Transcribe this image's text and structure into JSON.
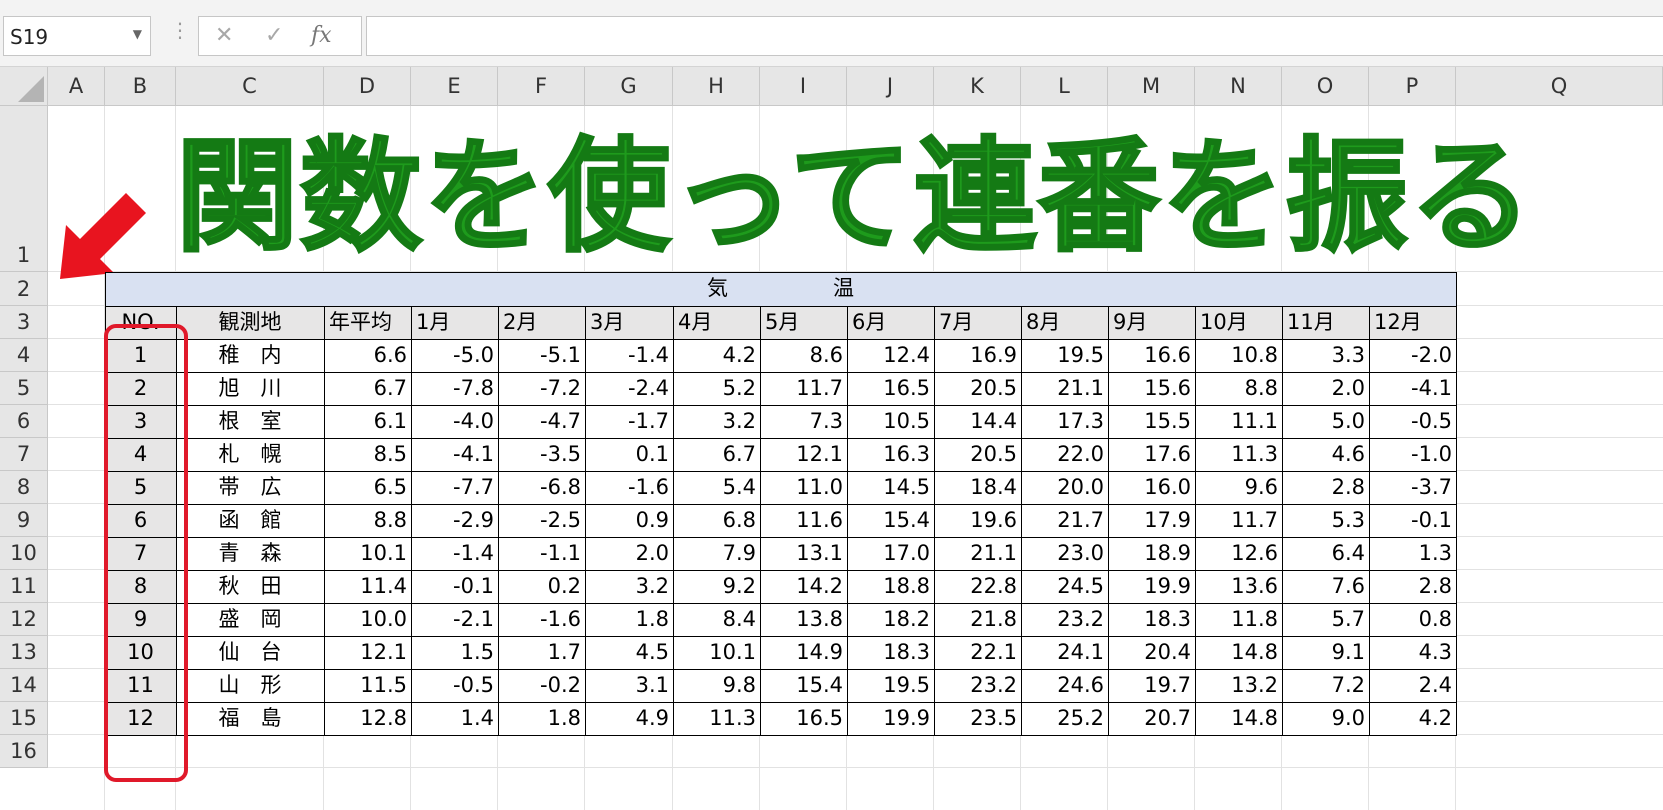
{
  "formula_bar": {
    "name_box": "S19",
    "cancel_icon": "✕",
    "enter_icon": "✓",
    "fx_label": "fx",
    "formula": ""
  },
  "columns": [
    "A",
    "B",
    "C",
    "D",
    "E",
    "F",
    "G",
    "H",
    "I",
    "J",
    "K",
    "L",
    "M",
    "N",
    "O",
    "P",
    "Q"
  ],
  "rows": [
    "1",
    "2",
    "3",
    "4",
    "5",
    "6",
    "7",
    "8",
    "9",
    "10",
    "11",
    "12",
    "13",
    "14",
    "15",
    "16"
  ],
  "title": "関数を使って連番を振る",
  "table": {
    "group_header": "気　　　　　温",
    "headers": [
      "NO.",
      "観測地",
      "年平均",
      "1月",
      "2月",
      "3月",
      "4月",
      "5月",
      "6月",
      "7月",
      "8月",
      "9月",
      "10月",
      "11月",
      "12月"
    ],
    "rows": [
      [
        "1",
        "稚　内",
        "6.6",
        "-5.0",
        "-5.1",
        "-1.4",
        "4.2",
        "8.6",
        "12.4",
        "16.9",
        "19.5",
        "16.6",
        "10.8",
        "3.3",
        "-2.0"
      ],
      [
        "2",
        "旭　川",
        "6.7",
        "-7.8",
        "-7.2",
        "-2.4",
        "5.2",
        "11.7",
        "16.5",
        "20.5",
        "21.1",
        "15.6",
        "8.8",
        "2.0",
        "-4.1"
      ],
      [
        "3",
        "根　室",
        "6.1",
        "-4.0",
        "-4.7",
        "-1.7",
        "3.2",
        "7.3",
        "10.5",
        "14.4",
        "17.3",
        "15.5",
        "11.1",
        "5.0",
        "-0.5"
      ],
      [
        "4",
        "札　幌",
        "8.5",
        "-4.1",
        "-3.5",
        "0.1",
        "6.7",
        "12.1",
        "16.3",
        "20.5",
        "22.0",
        "17.6",
        "11.3",
        "4.6",
        "-1.0"
      ],
      [
        "5",
        "帯　広",
        "6.5",
        "-7.7",
        "-6.8",
        "-1.6",
        "5.4",
        "11.0",
        "14.5",
        "18.4",
        "20.0",
        "16.0",
        "9.6",
        "2.8",
        "-3.7"
      ],
      [
        "6",
        "函　館",
        "8.8",
        "-2.9",
        "-2.5",
        "0.9",
        "6.8",
        "11.6",
        "15.4",
        "19.6",
        "21.7",
        "17.9",
        "11.7",
        "5.3",
        "-0.1"
      ],
      [
        "7",
        "青　森",
        "10.1",
        "-1.4",
        "-1.1",
        "2.0",
        "7.9",
        "13.1",
        "17.0",
        "21.1",
        "23.0",
        "18.9",
        "12.6",
        "6.4",
        "1.3"
      ],
      [
        "8",
        "秋　田",
        "11.4",
        "-0.1",
        "0.2",
        "3.2",
        "9.2",
        "14.2",
        "18.8",
        "22.8",
        "24.5",
        "19.9",
        "13.6",
        "7.6",
        "2.8"
      ],
      [
        "9",
        "盛　岡",
        "10.0",
        "-2.1",
        "-1.6",
        "1.8",
        "8.4",
        "13.8",
        "18.2",
        "21.8",
        "23.2",
        "18.3",
        "11.8",
        "5.7",
        "0.8"
      ],
      [
        "10",
        "仙　台",
        "12.1",
        "1.5",
        "1.7",
        "4.5",
        "10.1",
        "14.9",
        "18.3",
        "22.1",
        "24.1",
        "20.4",
        "14.8",
        "9.1",
        "4.3"
      ],
      [
        "11",
        "山　形",
        "11.5",
        "-0.5",
        "-0.2",
        "3.1",
        "9.8",
        "15.4",
        "19.5",
        "23.2",
        "24.6",
        "19.7",
        "13.2",
        "7.2",
        "2.4"
      ],
      [
        "12",
        "福　島",
        "12.8",
        "1.4",
        "1.8",
        "4.9",
        "11.3",
        "16.5",
        "19.9",
        "23.5",
        "25.2",
        "20.7",
        "14.8",
        "9.0",
        "4.2"
      ]
    ]
  },
  "colors": {
    "title_green": "#1e9b1c",
    "arrow_red": "#e8141f",
    "highlight_red": "#e0192a",
    "group_header_bg": "#d9e1f2",
    "header_bg": "#e7e6e6"
  }
}
